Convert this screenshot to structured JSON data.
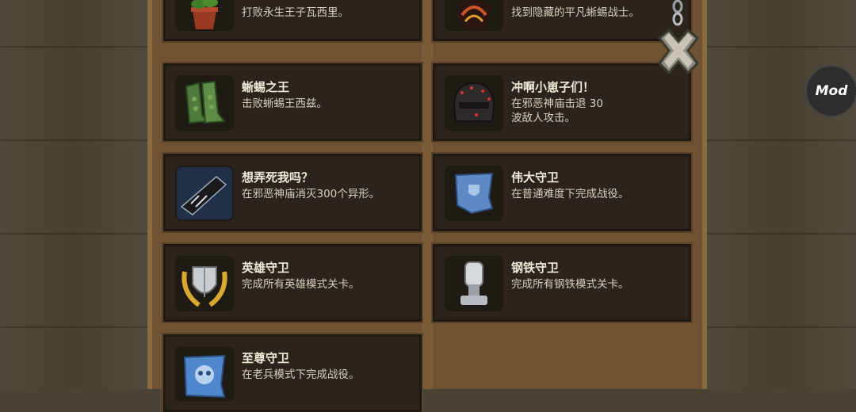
{
  "achievements": [
    {
      "title": "",
      "desc": "打败永生王子瓦西里。",
      "icon": "potted-plant-icon"
    },
    {
      "title": "",
      "desc": "找到隐藏的平凡蜥蜴战士。",
      "icon": "lizard-warrior-icon"
    },
    {
      "title": "蜥蜴之王",
      "desc": "击败蜥蜴王西兹。",
      "icon": "scaly-boots-icon"
    },
    {
      "title": "冲啊小崽子们！",
      "desc": "在邪恶神庙击退 30\n波敌人攻击。",
      "icon": "dark-helmet-icon"
    },
    {
      "title": "想弄死我吗？",
      "desc": "在邪恶神庙消灭300个异形。",
      "icon": "gun-icon"
    },
    {
      "title": "伟大守卫",
      "desc": "在普通难度下完成战役。",
      "icon": "blue-banner-shield-icon"
    },
    {
      "title": "英雄守卫",
      "desc": "完成所有英雄模式关卡。",
      "icon": "laurel-shield-icon"
    },
    {
      "title": "钢铁守卫",
      "desc": "完成所有钢铁模式关卡。",
      "icon": "iron-fist-trophy-icon"
    },
    {
      "title": "至尊守卫",
      "desc": "在老兵模式下完成战役。",
      "icon": "skull-banner-icon"
    }
  ],
  "mod_button": {
    "label": "Mod"
  },
  "close_icon": "close-icon",
  "colors": {
    "card_bg": "#2b241c",
    "board": "#6e5232",
    "title": "#f2ead8",
    "desc": "#d8cfbd"
  }
}
